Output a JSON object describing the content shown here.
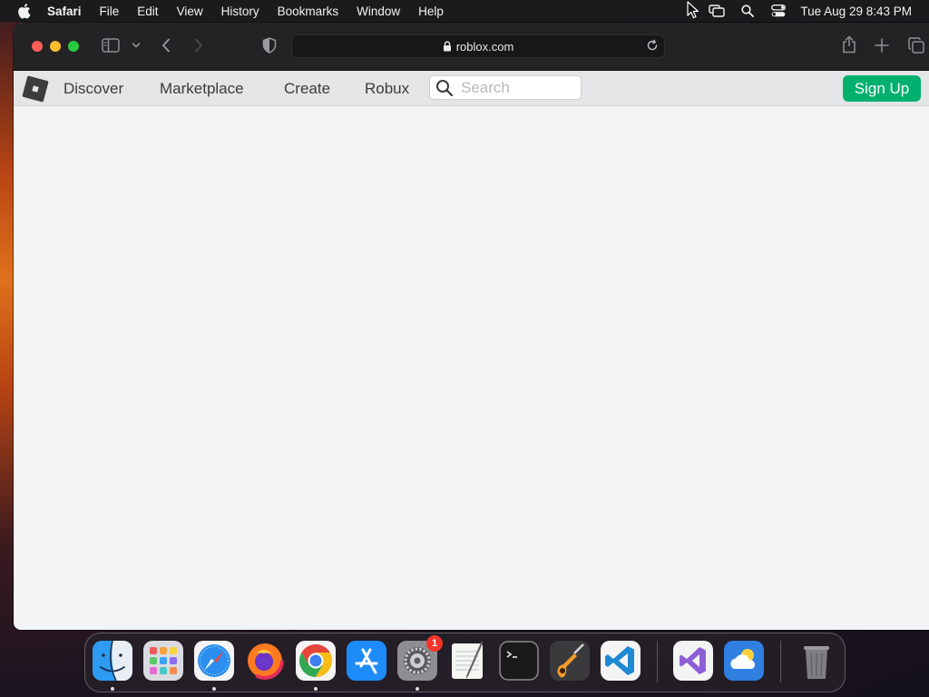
{
  "menubar": {
    "app_name": "Safari",
    "items": [
      "File",
      "Edit",
      "View",
      "History",
      "Bookmarks",
      "Window",
      "Help"
    ],
    "clock": "Tue Aug 29  8:43 PM"
  },
  "browser": {
    "url": "roblox.com"
  },
  "roblox": {
    "nav": [
      "Discover",
      "Marketplace",
      "Create",
      "Robux"
    ],
    "search_placeholder": "Search",
    "signup_label": "Sign Up"
  },
  "dock": {
    "apps": [
      "Finder",
      "Launchpad",
      "Safari",
      "Firefox",
      "Google Chrome",
      "App Store",
      "System Settings",
      "TextEdit",
      "Terminal",
      "GarageBand",
      "Visual Studio Code",
      "Visual Studio",
      "Weather",
      "Trash"
    ],
    "system_settings_badge": "1"
  },
  "colors": {
    "roblox_green": "#00b06f",
    "header_bg": "#e3e5e7",
    "page_bg": "#f2f4f5"
  }
}
